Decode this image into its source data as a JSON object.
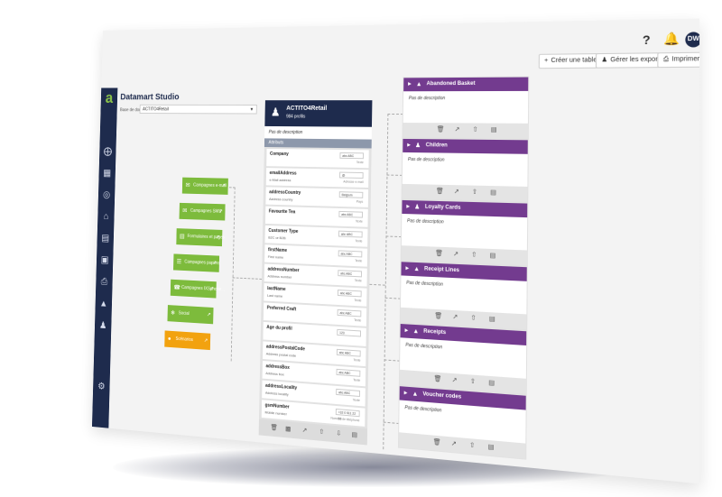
{
  "topbar": {
    "help_icon": "?",
    "bell_icon": "bell-icon",
    "avatar": "DW",
    "buttons": [
      {
        "label": "Créer une table",
        "icon": "+"
      },
      {
        "label": "Gérer les exports",
        "icon": "user-icon"
      },
      {
        "label": "Imprimer",
        "icon": "print-icon"
      }
    ]
  },
  "app": {
    "title": "Datamart Studio",
    "base_label": "Base de données",
    "base_value": "ACTITO4Retail"
  },
  "campaigns": [
    {
      "label": "Campagnes e-mail",
      "color": "#7dbb3c"
    },
    {
      "label": "Campagnes SMS",
      "color": "#7dbb3c"
    },
    {
      "label": "Formulaires et pages",
      "color": "#7dbb3c"
    },
    {
      "label": "Campagnes papiers",
      "color": "#7dbb3c"
    },
    {
      "label": "Campagnes IXSphone...",
      "color": "#7dbb3c"
    },
    {
      "label": "Social",
      "color": "#7dbb3c"
    },
    {
      "label": "Scénarios",
      "color": "#f2a20f"
    }
  ],
  "center_table": {
    "name": "ACTITO4Retail",
    "count": "984 profils",
    "description": "Pas de description",
    "attributes_label": "Attributs",
    "fields": [
      {
        "name": "Company",
        "sub": "",
        "box": "abc ABC",
        "type": "Texte"
      },
      {
        "name": "emailAddress",
        "sub": "e-Mail address",
        "box": "@",
        "type": "Adresse e-mail"
      },
      {
        "name": "addressCountry",
        "sub": "Address country",
        "box": "Belgium",
        "type": "Pays"
      },
      {
        "name": "Favourite Tea",
        "sub": "",
        "box": "abc ABC",
        "type": "Texte"
      },
      {
        "name": "Customer Type",
        "sub": "B2C or B2B",
        "box": "abc ABC",
        "type": "Texte"
      },
      {
        "name": "firstName",
        "sub": "First name",
        "box": "abc ABC",
        "type": "Texte"
      },
      {
        "name": "addressNumber",
        "sub": "Address number",
        "box": "abc ABC",
        "type": "Texte"
      },
      {
        "name": "lastName",
        "sub": "Last name",
        "box": "abc ABC",
        "type": "Texte"
      },
      {
        "name": "Preferred Craft",
        "sub": "",
        "box": "abc ABC",
        "type": "Texte"
      },
      {
        "name": "Age du profil",
        "sub": "",
        "box": "123",
        "type": ""
      },
      {
        "name": "addressPostalCode",
        "sub": "Address postal code",
        "box": "abc ABC",
        "type": "Texte"
      },
      {
        "name": "addressBox",
        "sub": "Address box",
        "box": "abc ABC",
        "type": "Texte"
      },
      {
        "name": "addressLocality",
        "sub": "Address locality",
        "box": "abc ABC",
        "type": "Texte"
      },
      {
        "name": "gsmNumber",
        "sub": "Mobile number",
        "box": "+32 0 511 22 33",
        "type": "Numéro de téléphone"
      }
    ],
    "footer_icons": [
      "trash-icon",
      "chart-icon",
      "external-link-icon",
      "upload-icon",
      "download-icon",
      "document-icon"
    ]
  },
  "cards": [
    {
      "name": "Abandoned Basket",
      "description": "Pas de description",
      "color": "#733b8f"
    },
    {
      "name": "Children",
      "description": "Pas de description",
      "color": "#733b8f"
    },
    {
      "name": "Loyalty Cards",
      "description": "Pas de description",
      "color": "#733b8f"
    },
    {
      "name": "Receipt Lines",
      "description": "Pas de description",
      "color": "#733b8f"
    },
    {
      "name": "Receipts",
      "description": "Pas de description",
      "color": "#733b8f"
    },
    {
      "name": "Voucher codes",
      "description": "Pas de description",
      "color": "#733b8f"
    }
  ]
}
